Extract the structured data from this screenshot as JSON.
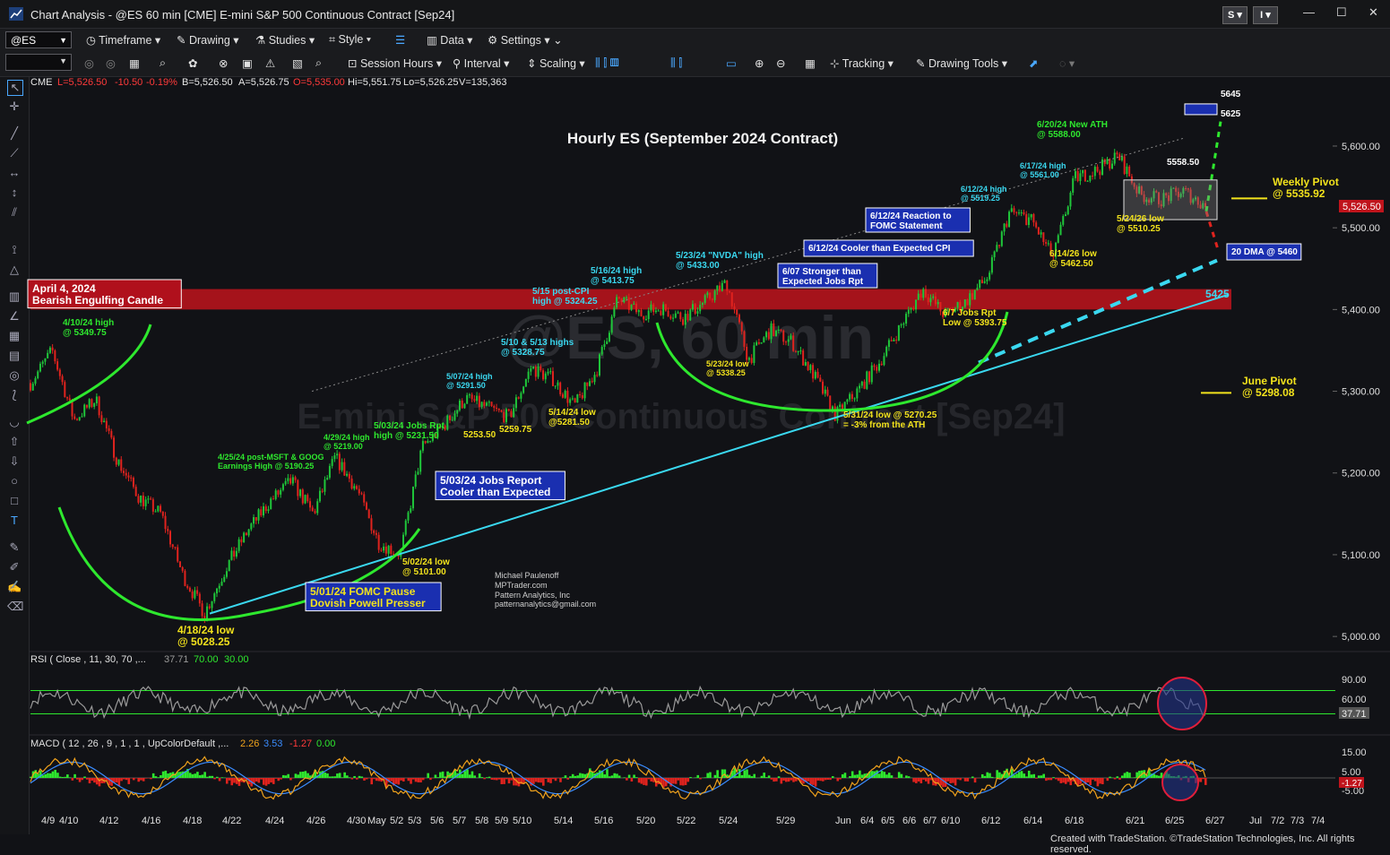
{
  "window": {
    "title": "Chart Analysis - @ES 60 min [CME] E-mini S&P 500 Continuous Contract [Sep24]",
    "s_button": "S",
    "i_button": "I"
  },
  "toolbar1": {
    "symbol": "@ES",
    "items": [
      "Timeframe",
      "Drawing",
      "Studies",
      "Style",
      "Data",
      "Settings"
    ]
  },
  "toolbar2": {
    "items": [
      "Session Hours",
      "Interval",
      "Scaling",
      "Tracking",
      "Drawing Tools"
    ]
  },
  "info_bar": {
    "exchange": "CME",
    "last": "L=5,526.50",
    "change": "-10.50",
    "pct": "-0.19%",
    "bid": "B=5,526.50",
    "ask": "A=5,526.75",
    "open": "O=5,535.00",
    "high": "Hi=5,551.75",
    "low": "Lo=5,526.25",
    "volume": "V=135,363"
  },
  "colors": {
    "background": "#111216",
    "up_candle": "#1fc63a",
    "down_candle": "#e0231e",
    "resistance_band": "#c0141c",
    "trendline": "#3ad8f0",
    "arc": "#2ee82e",
    "label_yellow": "#f2e21c",
    "label_green": "#2ee82e",
    "label_cyan": "#3ad8f0",
    "info_red": "#ff3a3a"
  },
  "chart_data": [
    {
      "type": "line",
      "title": "Hourly ES (September 2024 Contract)",
      "watermark_1": "@ES, 60 min",
      "watermark_2": "E-mini S&P 500 Continuous Contract [Sep24]",
      "xlabel": "",
      "ylabel": "",
      "x_tick_labels": [
        "4/9",
        "4/10",
        "4/12",
        "4/16",
        "4/18",
        "4/22",
        "4/24",
        "4/26",
        "4/30",
        "May",
        "5/2",
        "5/3",
        "5/6",
        "5/7",
        "5/8",
        "5/9",
        "5/10",
        "5/14",
        "5/16",
        "5/20",
        "5/22",
        "5/24",
        "5/29",
        "Jun",
        "6/4",
        "6/5",
        "6/6",
        "6/7",
        "6/10",
        "6/12",
        "6/14",
        "6/18",
        "6/21",
        "6/25",
        "6/27",
        "Jul",
        "7/2",
        "7/3",
        "7/4"
      ],
      "y_ticks": [
        "5,600.00",
        "5,500.00",
        "5,400.00",
        "5,300.00",
        "5,200.00",
        "5,100.00",
        "5,000.00"
      ],
      "y_tick_values": [
        5600,
        5500,
        5400,
        5300,
        5200,
        5100,
        5000
      ],
      "ylim": [
        4987,
        5680
      ],
      "series": [
        {
          "x": [
            "4/9",
            "4/10",
            "4/11",
            "4/12",
            "4/15",
            "4/16",
            "4/17",
            "4/18",
            "4/19",
            "4/22",
            "4/23",
            "4/24",
            "4/25",
            "4/26",
            "4/29",
            "4/30",
            "May",
            "5/2",
            "5/3",
            "5/6",
            "5/7",
            "5/8",
            "5/9",
            "5/10",
            "5/13",
            "5/14",
            "5/15",
            "5/16",
            "5/17",
            "5/20",
            "5/21",
            "5/22",
            "5/23",
            "5/24",
            "5/28",
            "5/29",
            "5/30",
            "5/31",
            "6/3",
            "6/4",
            "6/5",
            "6/6",
            "6/7",
            "6/10",
            "6/11",
            "6/12",
            "6/13",
            "6/14",
            "6/17",
            "6/18",
            "6/20",
            "6/21",
            "6/24",
            "6/25",
            "6/26"
          ],
          "values": [
            5310,
            5349.75,
            5265,
            5290,
            5215,
            5170,
            5150,
            5075,
            5028.25,
            5085,
            5130,
            5165,
            5190.25,
            5150,
            5219,
            5180,
            5115,
            5101,
            5231.5,
            5258,
            5291.5,
            5280,
            5268,
            5328.75,
            5315,
            5281.5,
            5324.25,
            5413.75,
            5395,
            5402,
            5390,
            5410,
            5433,
            5338.25,
            5375,
            5360,
            5320,
            5270.25,
            5300,
            5335,
            5380,
            5425,
            5393.75,
            5410,
            5440,
            5519.25,
            5510,
            5462.5,
            5561,
            5570,
            5588,
            5540,
            5535,
            5545,
            5526.5
          ]
        }
      ],
      "annotations": [
        {
          "text": "April 4, 2024",
          "text2": "Bearish Engulfing Candle"
        },
        {
          "text": "4/10/24 high",
          "text2": "@ 5349.75"
        },
        {
          "text": "4/18/24 low",
          "text2": "@ 5028.25"
        },
        {
          "text": "4/25/24 post-MSFT & GOOG",
          "text2": "Earnings High @ 5190.25"
        },
        {
          "text": "4/29/24 high",
          "text2": "@ 5219.00"
        },
        {
          "text": "5/01/24 FOMC Pause",
          "text2": "Dovish Powell Presser"
        },
        {
          "text": "5/02/24 low",
          "text2": "@ 5101.00"
        },
        {
          "text": "5/03/24 Jobs Rpt",
          "text2": "high @ 5231.50"
        },
        {
          "text": "5/03/24 Jobs Report",
          "text2": "Cooler than Expected"
        },
        {
          "text": "5253.50",
          "text2": ""
        },
        {
          "text": "5259.75",
          "text2": ""
        },
        {
          "text": "5/07/24 high",
          "text2": "@ 5291.50"
        },
        {
          "text": "5/10 & 5/13 highs",
          "text2": "@ 5328.75"
        },
        {
          "text": "5/14/24 low",
          "text2": "@5281.50"
        },
        {
          "text": "5/15 post-CPI",
          "text2": "high @ 5324.25"
        },
        {
          "text": "5/16/24 high",
          "text2": "@ 5413.75"
        },
        {
          "text": "5/23/24 \"NVDA\" high",
          "text2": "@ 5433.00"
        },
        {
          "text": "5/23/24 low",
          "text2": "@ 5338.25"
        },
        {
          "text": "5/31/24 low @ 5270.25",
          "text2": "= -3% from the ATH"
        },
        {
          "text": "6/07 Stronger than",
          "text2": "Expected Jobs Rpt"
        },
        {
          "text": "6/7 Jobs Rpt",
          "text2": "Low @ 5393.75"
        },
        {
          "text": "6/12/24 Cooler than Expected CPI",
          "text2": ""
        },
        {
          "text": "6/12/24 Reaction to",
          "text2": "FOMC Statement"
        },
        {
          "text": "6/12/24 high",
          "text2": "@ 5519.25"
        },
        {
          "text": "6/14/26 low",
          "text2": "@ 5462.50"
        },
        {
          "text": "6/17/24 high",
          "text2": "@ 5561.00"
        },
        {
          "text": "6/20/24 New ATH",
          "text2": "@ 5588.00"
        },
        {
          "text": "5/24/26 low",
          "text2": "@ 5510.25"
        },
        {
          "text": "5558.50",
          "text2": ""
        },
        {
          "text": "5645",
          "text2": ""
        },
        {
          "text": "5625",
          "text2": ""
        },
        {
          "text": "Weekly Pivot",
          "text2": "@ 5535.92"
        },
        {
          "text": "20 DMA @ 5460",
          "text2": ""
        },
        {
          "text": "5425",
          "text2": ""
        },
        {
          "text": "June Pivot",
          "text2": "@ 5298.08"
        }
      ],
      "author": [
        "Michael Paulenoff",
        "MPTrader.com",
        "Pattern Analytics, Inc",
        "patternanalytics@gmail.com"
      ],
      "last_price_tag": "5,526.50"
    },
    {
      "type": "line",
      "title": "RSI",
      "params": "RSI ( Close , 11, 30, 70 ,...",
      "value_text": "37.71",
      "ob_text": "70.00",
      "os_text": "30.00",
      "y_ticks": [
        "90.00",
        "60.00"
      ],
      "ylim": [
        20,
        100
      ],
      "last_tag": "37.71"
    },
    {
      "type": "line",
      "title": "MACD",
      "params": "MACD ( 12 , 26 , 9 , 1 , 1 , UpColorDefault ,...",
      "v1": "2.26",
      "v2": "3.53",
      "v3": "-1.27",
      "v4": "0.00",
      "y_ticks": [
        "15.00",
        "5.00",
        "-5.00"
      ],
      "last_tag": "-1.27"
    }
  ],
  "footer": "Created with TradeStation. ©TradeStation Technologies, Inc. All rights reserved."
}
